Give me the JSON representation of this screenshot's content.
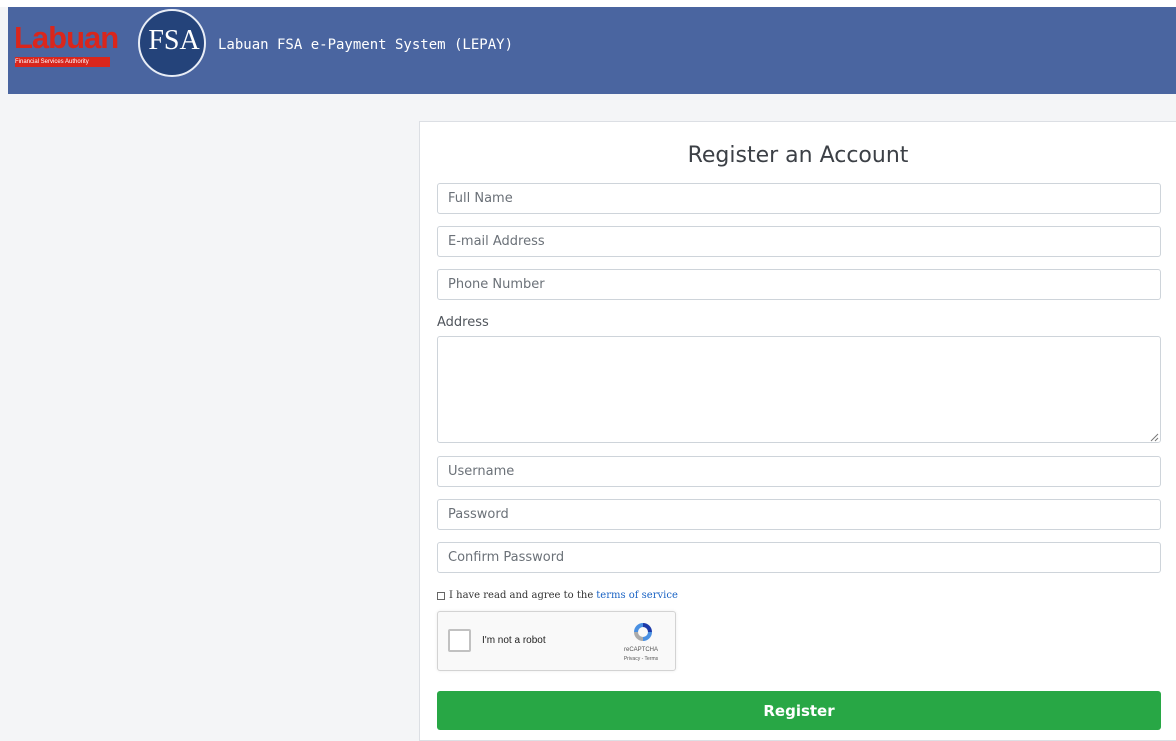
{
  "top_strip_text": "",
  "header": {
    "logo_word": "Labuan",
    "logo_fsa": "FSA",
    "logo_sub": "Financial Services Authority",
    "title": "Labuan FSA e-Payment System (LEPAY)"
  },
  "form": {
    "title": "Register an Account",
    "full_name_placeholder": "Full Name",
    "email_placeholder": "E-mail Address",
    "phone_placeholder": "Phone Number",
    "address_label": "Address",
    "username_placeholder": "Username",
    "password_placeholder": "Password",
    "confirm_password_placeholder": "Confirm Password",
    "terms_text": "I have read and agree to the",
    "terms_link": "terms of service",
    "recaptcha_label": "I'm not a robot",
    "recaptcha_brand": "reCAPTCHA",
    "recaptcha_links": "Privacy - Terms",
    "register_label": "Register"
  },
  "colors": {
    "header_bg": "#4a65a0",
    "button_green": "#28a745",
    "link_blue": "#1a63c4",
    "logo_red": "#d9261c"
  }
}
